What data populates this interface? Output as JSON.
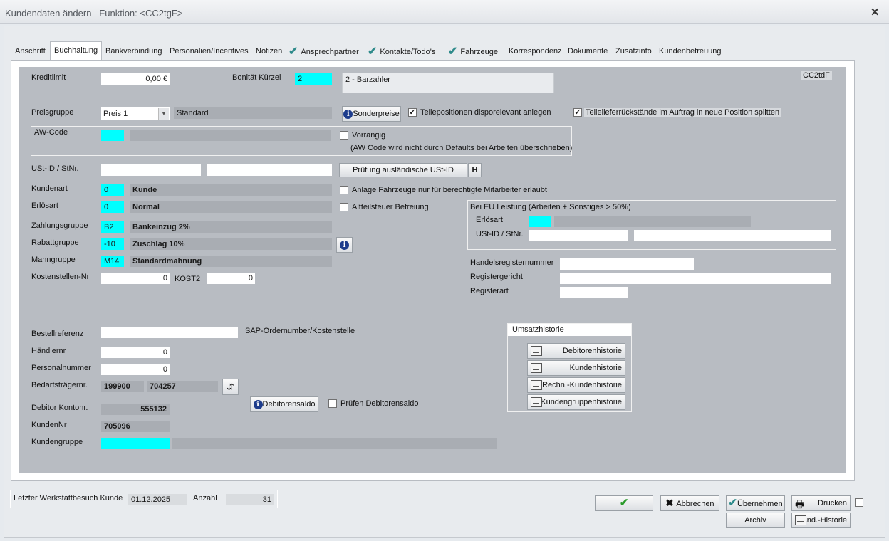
{
  "window": {
    "title": "Kundendaten ändern",
    "function_label": "Funktion: <CC2tgF>"
  },
  "tabs": [
    {
      "label": "Anschrift",
      "checked": false,
      "active": false
    },
    {
      "label": "Buchhaltung",
      "checked": false,
      "active": true
    },
    {
      "label": "Bankverbindung",
      "checked": false,
      "active": false
    },
    {
      "label": "Personalien/Incentives",
      "checked": false,
      "active": false
    },
    {
      "label": "Notizen",
      "checked": false,
      "active": false
    },
    {
      "label": "Ansprechpartner",
      "checked": true,
      "active": false
    },
    {
      "label": "Kontakte/Todo's",
      "checked": true,
      "active": false
    },
    {
      "label": "Fahrzeuge",
      "checked": true,
      "active": false
    },
    {
      "label": "Korrespondenz",
      "checked": false,
      "active": false
    },
    {
      "label": "Dokumente",
      "checked": false,
      "active": false
    },
    {
      "label": "Zusatzinfo",
      "checked": false,
      "active": false
    },
    {
      "label": "Kundenbetreuung",
      "checked": false,
      "active": false
    }
  ],
  "form": {
    "code": "CC2tdF",
    "kreditlimit": {
      "label": "Kreditlimit",
      "value": "0,00 €"
    },
    "bonitaet": {
      "label": "Bonität Kürzel",
      "code": "2",
      "text": "2 - Barzahler"
    },
    "preisgruppe": {
      "label": "Preisgruppe",
      "value": "Preis 1",
      "text": "Standard"
    },
    "sonderpreise_button": "Sonderpreise",
    "teilepositionen": {
      "label": "Teilepositionen disporelevant anlegen",
      "checked": true
    },
    "teilelieferrueckstaende": {
      "label": "Teilelieferrückstände im Auftrag in neue Position splitten",
      "checked": true
    },
    "aw_code": {
      "label": "AW-Code",
      "code": "",
      "text": ""
    },
    "vorrangig": {
      "label": "Vorrangig",
      "checked": false,
      "note": "(AW Code wird nicht durch Defaults bei Arbeiten überschrieben)"
    },
    "ust": {
      "label": "USt-ID / StNr.",
      "ust_id": "",
      "st_nr": ""
    },
    "pruefung_button": "Prüfung ausländische USt-ID",
    "h_button": "H",
    "kundenart": {
      "label": "Kundenart",
      "code": "0",
      "text": "Kunde"
    },
    "anlage_fahrzeuge": {
      "label": "Anlage Fahrzeuge nur für berechtigte Mitarbeiter erlaubt",
      "checked": false
    },
    "erloesart": {
      "label": "Erlösart",
      "code": "0",
      "text": "Normal"
    },
    "altteilsteuer": {
      "label": "Altteilsteuer Befreiung",
      "checked": false
    },
    "zahlungsgruppe": {
      "label": "Zahlungsgruppe",
      "code": "B2",
      "text": "Bankeinzug 2%"
    },
    "rabattgruppe": {
      "label": "Rabattgruppe",
      "code": "-10",
      "text": "Zuschlag 10%"
    },
    "mahngruppe": {
      "label": "Mahngruppe",
      "code": "M14",
      "text": "Standardmahnung"
    },
    "kostenstellen": {
      "label": "Kostenstellen-Nr",
      "value": "0",
      "kost2_label": "KOST2",
      "kost2_value": "0"
    },
    "eu": {
      "title": "Bei EU Leistung (Arbeiten + Sonstiges > 50%)",
      "erloesart_label": "Erlösart",
      "ust_label": "USt-ID / StNr.",
      "erloesart_code": "",
      "erloesart_text": "",
      "ust_id": "",
      "st_nr": ""
    },
    "handelsregisternummer": {
      "label": "Handelsregisternummer",
      "value": ""
    },
    "registergericht": {
      "label": "Registergericht",
      "value": ""
    },
    "registerart": {
      "label": "Registerart",
      "value": ""
    },
    "bestellreferenz": {
      "label": "Bestellreferenz",
      "value": "",
      "hint": "SAP-Ordernumber/Kostenstelle"
    },
    "haendlernr": {
      "label": "Händlernr",
      "value": "0"
    },
    "personalnummer": {
      "label": "Personalnummer",
      "value": "0"
    },
    "bedarfstraeger": {
      "label": "Bedarfsträgernr.",
      "value1": "199900",
      "value2": "704257"
    },
    "debitor_kontonr": {
      "label": "Debitor Kontonr.",
      "value": "555132"
    },
    "debitorensaldo_button": "Debitorensaldo",
    "pruefen_debitorensaldo": {
      "label": "Prüfen Debitorensaldo",
      "checked": false
    },
    "kundennr": {
      "label": "KundenNr",
      "value": "705096"
    },
    "kundengruppe": {
      "label": "Kundengruppe",
      "code": "",
      "text": ""
    }
  },
  "umsatzhistorie": {
    "title": "Umsatzhistorie",
    "buttons": [
      "Debitorenhistorie",
      "Kundenhistorie",
      "Rechn.-Kundenhistorie",
      "Kundengruppenhistorie"
    ]
  },
  "status": {
    "letzter_label": "Letzter Werkstattbesuch Kunde",
    "letzter_value": "01.12.2025",
    "anzahl_label": "Anzahl",
    "anzahl_value": "31"
  },
  "actions": {
    "ok": "",
    "abbrechen": "Abbrechen",
    "uebernehmen": "Übernehmen",
    "drucken": "Drucken",
    "archiv": "Archiv",
    "aend_historie": "Änd.-Historie"
  },
  "colors": {
    "accent_cyan": "#00ffff",
    "panel": "#b8bcc2",
    "readonly": "#a9adb3",
    "check_teal": "#2f8b8b"
  }
}
